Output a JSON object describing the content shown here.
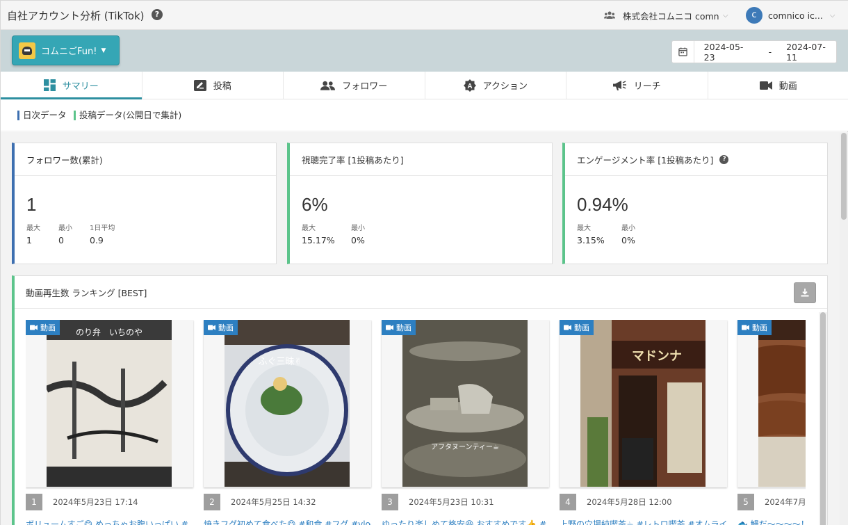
{
  "header": {
    "title": "自社アカウント分析 (TikTok)",
    "company": "株式会社コムニコ comnico",
    "account_initial": "c",
    "account_name": "comnico ic..."
  },
  "toolbar": {
    "brand_name": "コムニごFun!",
    "date_from": "2024-05-23",
    "date_sep": "-",
    "date_to": "2024-07-11"
  },
  "tabs": [
    {
      "label": "サマリー",
      "icon": "dashboard-icon",
      "active": true
    },
    {
      "label": "投稿",
      "icon": "edit-post-icon"
    },
    {
      "label": "フォロワー",
      "icon": "people-icon"
    },
    {
      "label": "アクション",
      "icon": "action-icon"
    },
    {
      "label": "リーチ",
      "icon": "megaphone-icon"
    },
    {
      "label": "動画",
      "icon": "video-icon"
    }
  ],
  "legend": {
    "daily": "日次データ",
    "post": "投稿データ(公開日で集計)"
  },
  "cards": [
    {
      "title": "フォロワー数(累計)",
      "value": "1",
      "stats": [
        {
          "label": "最大",
          "value": "1"
        },
        {
          "label": "最小",
          "value": "0"
        },
        {
          "label": "1日平均",
          "value": "0.9"
        }
      ]
    },
    {
      "title": "視聴完了率 [1投稿あたり]",
      "value": "6%",
      "stats": [
        {
          "label": "最大",
          "value": "15.17%"
        },
        {
          "label": "最小",
          "value": "0%"
        }
      ]
    },
    {
      "title": "エンゲージメント率 [1投稿あたり]",
      "value": "0.94%",
      "stats": [
        {
          "label": "最大",
          "value": "3.15%"
        },
        {
          "label": "最小",
          "value": "0%"
        }
      ]
    }
  ],
  "ranking": {
    "title": "動画再生数 ランキング [BEST]",
    "badge": "動画",
    "items": [
      {
        "rank": "1",
        "date": "2024年5月23日 17:14",
        "caption": "ボリュームすご😋 めっちゃお腹いっぱい #",
        "overlay": "のり弁　いちのや",
        "colors": {
          "top": "#3a3a3a",
          "bottom": "#e8e4dc"
        }
      },
      {
        "rank": "2",
        "date": "2024年5月25日 14:32",
        "caption": "焼きフグ初めて食べた😋 #和食 #フグ #vlog",
        "overlay": "ふぐ三昧✌",
        "colors": {
          "top": "#4a4038",
          "bottom": "#d9dce0"
        }
      },
      {
        "rank": "3",
        "date": "2024年5月23日 10:31",
        "caption": "ゆったり楽しめて格安😆 おすすめです👍 #",
        "overlay": "アフタヌーンティー☕",
        "colors": {
          "top": "#4d4a40",
          "bottom": "#6d6a5e"
        }
      },
      {
        "rank": "4",
        "date": "2024年5月28日 12:00",
        "caption": "上野の穴場純喫茶☕ #レトロ喫茶 #オムライ",
        "overlay": "",
        "colors": {
          "top": "#c9b8a0",
          "bottom": "#5a3a28"
        }
      },
      {
        "rank": "5",
        "date": "2024年7月",
        "caption": "🐟 鰻だ〜〜〜〜！",
        "overlay": "",
        "colors": {
          "top": "#3d2418",
          "bottom": "#8a5030"
        }
      }
    ]
  }
}
